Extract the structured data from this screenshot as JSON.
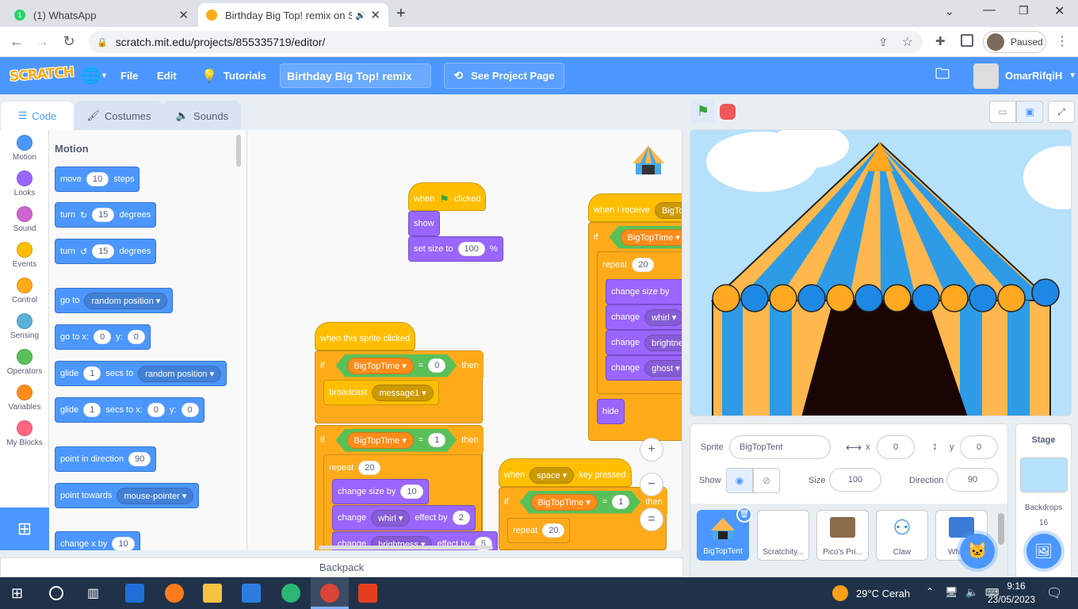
{
  "browser": {
    "tabs": [
      {
        "title": "(1) WhatsApp",
        "badge": "1"
      },
      {
        "title": "Birthday Big Top! remix on Sc"
      }
    ],
    "url": "scratch.mit.edu/projects/855335719/editor/",
    "profile_status": "Paused",
    "new_tab_label": "+"
  },
  "menubar": {
    "logo": "SCRATCH",
    "file": "File",
    "edit": "Edit",
    "tutorials": "Tutorials",
    "project_title": "Birthday Big Top! remix",
    "see_project": "See Project Page",
    "username": "OmarRifqiH"
  },
  "editor_tabs": {
    "code": "Code",
    "costumes": "Costumes",
    "sounds": "Sounds"
  },
  "categories": [
    {
      "label": "Motion",
      "color": "#4c97ff"
    },
    {
      "label": "Looks",
      "color": "#9966ff"
    },
    {
      "label": "Sound",
      "color": "#cf63cf"
    },
    {
      "label": "Events",
      "color": "#ffbf00"
    },
    {
      "label": "Control",
      "color": "#ffab19"
    },
    {
      "label": "Sensing",
      "color": "#5cb1d6"
    },
    {
      "label": "Operators",
      "color": "#59c059"
    },
    {
      "label": "Variables",
      "color": "#ff8c1a"
    },
    {
      "label": "My Blocks",
      "color": "#ff6680"
    }
  ],
  "palette": {
    "heading": "Motion",
    "move": {
      "pre": "move",
      "val": "10",
      "post": "steps"
    },
    "turn_right": {
      "pre": "turn",
      "val": "15",
      "post": "degrees"
    },
    "turn_left": {
      "pre": "turn",
      "val": "15",
      "post": "degrees"
    },
    "goto": {
      "pre": "go to",
      "menu": "random position"
    },
    "gotoxy": {
      "pre": "go to x:",
      "x": "0",
      "ymid": "y:",
      "y": "0"
    },
    "glide1": {
      "pre": "glide",
      "val": "1",
      "mid": "secs to",
      "menu": "random position"
    },
    "glide2": {
      "pre": "glide",
      "val": "1",
      "mid": "secs to x:",
      "x": "0",
      "ymid": "y:",
      "y": "0"
    },
    "point_dir": {
      "pre": "point in direction",
      "val": "90"
    },
    "point_towards": {
      "pre": "point towards",
      "menu": "mouse-pointer"
    },
    "changex": {
      "pre": "change x by",
      "val": "10"
    }
  },
  "scripts": {
    "flag": {
      "when": "when",
      "clicked": "clicked",
      "show": "show",
      "setsize": "set size to",
      "size": "100",
      "pct": "%"
    },
    "sprite_clicked": {
      "hat": "when this sprite clicked",
      "if1": "if",
      "var1": "BigTopTime",
      "eq1": "=",
      "val1": "0",
      "then1": "then",
      "broadcast": "broadcast",
      "msg": "message1",
      "if2": "if",
      "var2": "BigTopTime",
      "eq2": "=",
      "val2": "1",
      "then2": "then",
      "repeat": "repeat",
      "rep": "20",
      "changesize": "change size by",
      "cs": "10",
      "change": "change",
      "effect_menu": "whirl",
      "effectby": "effect by",
      "ev": "2",
      "change2": "change",
      "effect2": "brightness",
      "effectby2": "effect by",
      "ev2": "5"
    },
    "receive": {
      "hat": "when I receive",
      "msg": "BigTo",
      "if": "if",
      "var": "BigTopTime",
      "repeat": "repeat",
      "rep": "20",
      "changesize": "change size by",
      "c1": "change",
      "e1": "whirl",
      "c2": "change",
      "e2": "brightne",
      "c3": "change",
      "e3": "ghost",
      "hide": "hide"
    },
    "space": {
      "when": "when",
      "key": "space",
      "pressed": "key pressed",
      "if": "if",
      "var": "BigTopTime",
      "eq": "=",
      "val": "1",
      "then": "then",
      "repeat": "repeat",
      "rep": "20"
    }
  },
  "zoom": {
    "in": "+",
    "out": "−",
    "reset": "="
  },
  "backpack": "Backpack",
  "sprite_info": {
    "sprite_label": "Sprite",
    "sprite_name": "BigTopTent",
    "x_label": "x",
    "x": "0",
    "y_label": "y",
    "y": "0",
    "show_label": "Show",
    "size_label": "Size",
    "size": "100",
    "direction_label": "Direction",
    "direction": "90"
  },
  "sprites": [
    "BigTopTent",
    "Scratchity...",
    "Pico's Pri...",
    "Claw",
    "Whac..."
  ],
  "stage_pane": {
    "title": "Stage",
    "backdrops_label": "Backdrops",
    "backdrops_count": "16"
  },
  "taskbar": {
    "weather": "29°C  Cerah",
    "time": "9:16",
    "date": "23/05/2023"
  }
}
